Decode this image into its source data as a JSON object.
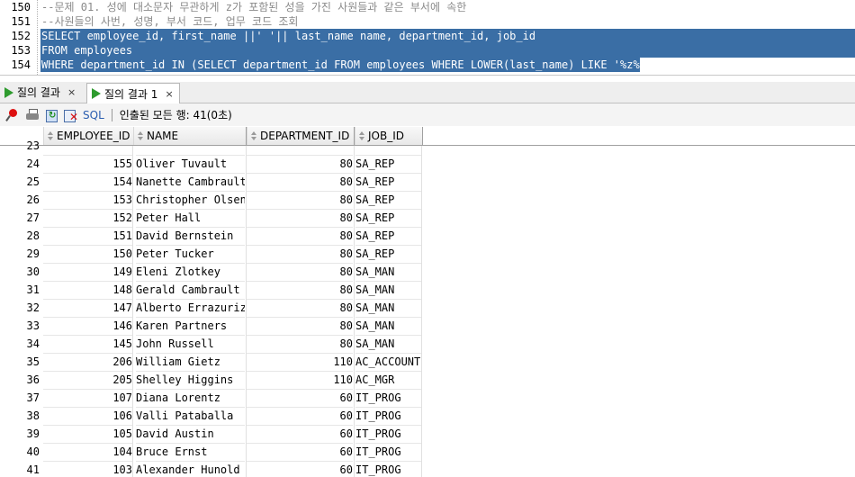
{
  "editor": {
    "lines": [
      {
        "num": "150",
        "text": "--문제 01. 성에 대소문자 무관하게 z가 포함된 성을 가진 사원들과 같은 부서에 속한",
        "kind": "comment"
      },
      {
        "num": "151",
        "text": "--사원들의 사번, 성명, 부서 코드, 업무 코드 조회",
        "kind": "comment"
      },
      {
        "num": "152",
        "text": "SELECT employee_id, first_name ||' '|| last_name name, department_id, job_id",
        "kind": "selected"
      },
      {
        "num": "153",
        "text": "FROM employees",
        "kind": "selected"
      },
      {
        "num": "154",
        "text": "WHERE department_id IN (SELECT department_id FROM employees WHERE LOWER(last_name) LIKE '%z%');",
        "kind": "selected"
      }
    ]
  },
  "tabs": [
    {
      "label": "질의 결과",
      "close": "×"
    },
    {
      "label": "질의 결과 1",
      "close": "×"
    }
  ],
  "toolbar": {
    "sql_label": "SQL",
    "status": "인출된 모든 행: 41(0초)"
  },
  "grid": {
    "columns": [
      "EMPLOYEE_ID",
      "NAME",
      "DEPARTMENT_ID",
      "JOB_ID"
    ],
    "rows": [
      {
        "n": "23",
        "id": "",
        "name": "",
        "dept": "",
        "job": ""
      },
      {
        "n": "24",
        "id": "155",
        "name": "Oliver Tuvault",
        "dept": "80",
        "job": "SA_REP"
      },
      {
        "n": "25",
        "id": "154",
        "name": "Nanette Cambrault",
        "dept": "80",
        "job": "SA_REP"
      },
      {
        "n": "26",
        "id": "153",
        "name": "Christopher Olsen",
        "dept": "80",
        "job": "SA_REP"
      },
      {
        "n": "27",
        "id": "152",
        "name": "Peter Hall",
        "dept": "80",
        "job": "SA_REP"
      },
      {
        "n": "28",
        "id": "151",
        "name": "David Bernstein",
        "dept": "80",
        "job": "SA_REP"
      },
      {
        "n": "29",
        "id": "150",
        "name": "Peter Tucker",
        "dept": "80",
        "job": "SA_REP"
      },
      {
        "n": "30",
        "id": "149",
        "name": "Eleni Zlotkey",
        "dept": "80",
        "job": "SA_MAN"
      },
      {
        "n": "31",
        "id": "148",
        "name": "Gerald Cambrault",
        "dept": "80",
        "job": "SA_MAN"
      },
      {
        "n": "32",
        "id": "147",
        "name": "Alberto Errazuriz",
        "dept": "80",
        "job": "SA_MAN"
      },
      {
        "n": "33",
        "id": "146",
        "name": "Karen Partners",
        "dept": "80",
        "job": "SA_MAN"
      },
      {
        "n": "34",
        "id": "145",
        "name": "John Russell",
        "dept": "80",
        "job": "SA_MAN"
      },
      {
        "n": "35",
        "id": "206",
        "name": "William Gietz",
        "dept": "110",
        "job": "AC_ACCOUNT"
      },
      {
        "n": "36",
        "id": "205",
        "name": "Shelley Higgins",
        "dept": "110",
        "job": "AC_MGR"
      },
      {
        "n": "37",
        "id": "107",
        "name": "Diana Lorentz",
        "dept": "60",
        "job": "IT_PROG"
      },
      {
        "n": "38",
        "id": "106",
        "name": "Valli Pataballa",
        "dept": "60",
        "job": "IT_PROG"
      },
      {
        "n": "39",
        "id": "105",
        "name": "David Austin",
        "dept": "60",
        "job": "IT_PROG"
      },
      {
        "n": "40",
        "id": "104",
        "name": "Bruce Ernst",
        "dept": "60",
        "job": "IT_PROG"
      },
      {
        "n": "41",
        "id": "103",
        "name": "Alexander Hunold",
        "dept": "60",
        "job": "IT_PROG"
      }
    ]
  }
}
